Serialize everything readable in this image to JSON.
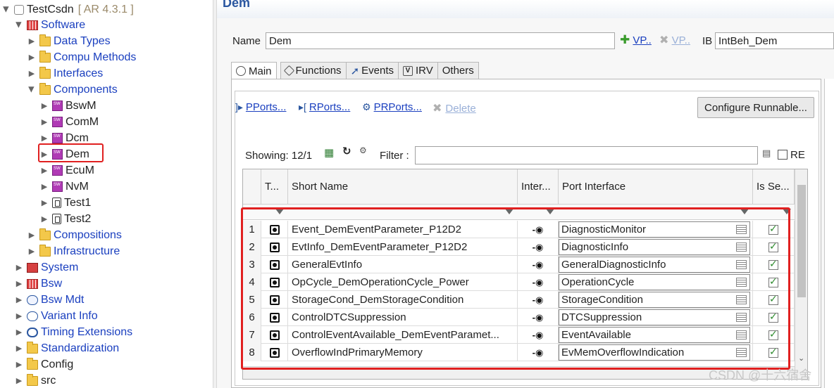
{
  "tree": {
    "project": {
      "name": "TestCsdn",
      "version": "[ AR 4.3.1 ]"
    },
    "software": "Software",
    "software_children": [
      "Data Types",
      "Compu Methods",
      "Interfaces"
    ],
    "components": "Components",
    "component_items": [
      "BswM",
      "ComM",
      "Dcm",
      "Dem",
      "EcuM",
      "NvM",
      "Test1",
      "Test2"
    ],
    "after_components": [
      "Compositions",
      "Infrastructure"
    ],
    "top_level": [
      "System",
      "Bsw",
      "Bsw Mdt",
      "Variant Info",
      "Timing Extensions",
      "Standardization",
      "Config",
      "src"
    ],
    "selected": "Dem"
  },
  "editor": {
    "title": "Dem",
    "name_label": "Name",
    "name_value": "Dem",
    "vp_link": "VP..",
    "vp_disabled_link": "VP..",
    "ib_label": "IB",
    "ib_value": "IntBeh_Dem",
    "tabs": [
      "Main",
      "Functions",
      "Events",
      "IRV",
      "Others"
    ],
    "active_tab": "Main"
  },
  "toolbar": {
    "pports": "PPorts...",
    "rports": "RPorts...",
    "prports": "PRPorts...",
    "delete": "Delete",
    "configure_runnable": "Configure Runnable..."
  },
  "filter": {
    "showing": "Showing: 12/1",
    "filter_label": "Filter :",
    "re_label": "RE"
  },
  "table": {
    "headers": [
      "T...",
      "Short Name",
      "Inter...",
      "Port Interface",
      "Is Se..."
    ],
    "rows": [
      {
        "n": "1",
        "short_name": "Event_DemEventParameter_P12D2",
        "port_interface": "DiagnosticMonitor",
        "checked": true
      },
      {
        "n": "2",
        "short_name": "EvtInfo_DemEventParameter_P12D2",
        "port_interface": "DiagnosticInfo",
        "checked": true
      },
      {
        "n": "3",
        "short_name": "GeneralEvtInfo",
        "port_interface": "GeneralDiagnosticInfo",
        "checked": true
      },
      {
        "n": "4",
        "short_name": "OpCycle_DemOperationCycle_Power",
        "port_interface": "OperationCycle",
        "checked": true
      },
      {
        "n": "5",
        "short_name": "StorageCond_DemStorageCondition",
        "port_interface": "StorageCondition",
        "checked": true
      },
      {
        "n": "6",
        "short_name": "ControlDTCSuppression",
        "port_interface": "DTCSuppression",
        "checked": true
      },
      {
        "n": "7",
        "short_name": "ControlEventAvailable_DemEventParamet...",
        "port_interface": "EventAvailable",
        "checked": true
      },
      {
        "n": "8",
        "short_name": "OverflowIndPrimaryMemory",
        "port_interface": "EvMemOverflowIndication",
        "checked": true
      }
    ]
  },
  "watermark": "CSDN @十六宿舍"
}
